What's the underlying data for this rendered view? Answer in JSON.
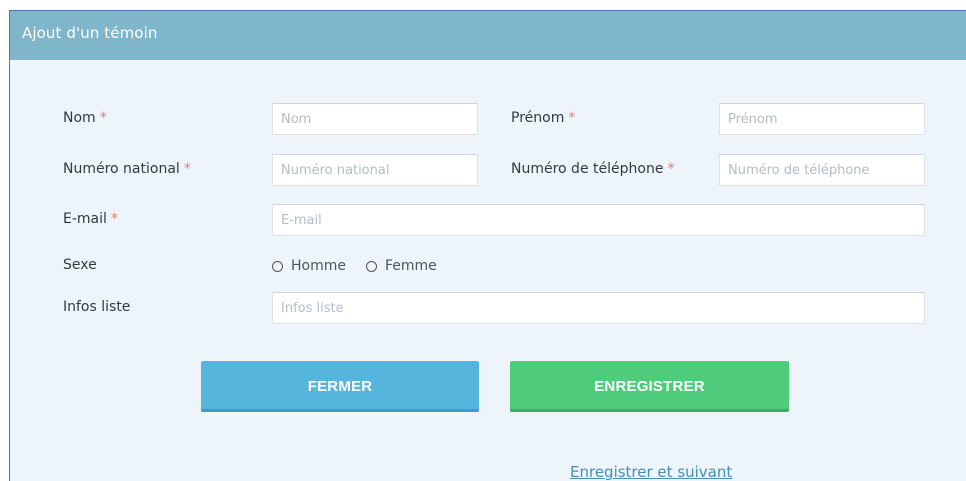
{
  "dialog": {
    "title": "Ajout d'un témoin"
  },
  "form": {
    "required_mark": "*",
    "nom": {
      "label": "Nom",
      "placeholder": "Nom",
      "value": ""
    },
    "prenom": {
      "label": "Prénom",
      "placeholder": "Prénom",
      "value": ""
    },
    "numero_national": {
      "label": "Numéro national",
      "placeholder": "Numéro national",
      "value": ""
    },
    "telephone": {
      "label": "Numéro de téléphone",
      "placeholder": "Numéro de téléphone",
      "value": ""
    },
    "email": {
      "label": "E-mail",
      "placeholder": "E-mail",
      "value": ""
    },
    "sexe": {
      "label": "Sexe",
      "options": [
        "Homme",
        "Femme"
      ],
      "selected": null
    },
    "infos_liste": {
      "label": "Infos liste",
      "placeholder": "Infos liste",
      "value": ""
    }
  },
  "buttons": {
    "close": "FERMER",
    "save": "ENREGISTRER",
    "save_next": "Enregistrer et suivant"
  },
  "colors": {
    "header": "#7fb6c9",
    "close_button": "#55b5dd",
    "save_button": "#4ecc7c",
    "required": "#e07b7b",
    "link": "#4a8cb8"
  }
}
